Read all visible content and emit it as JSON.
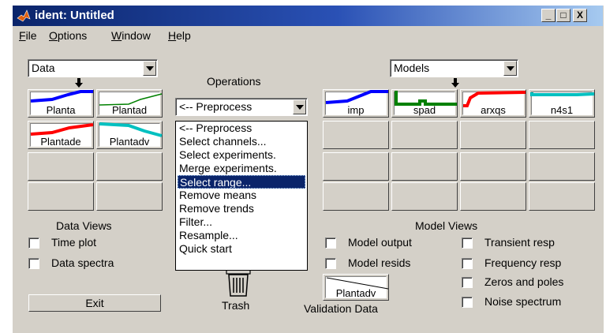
{
  "window": {
    "title": "ident: Untitled",
    "min": "_",
    "max": "□",
    "close": "X"
  },
  "menu": [
    {
      "first": "F",
      "rest": "ile"
    },
    {
      "first": "O",
      "rest": "ptions"
    },
    {
      "first": "W",
      "rest": "indow"
    },
    {
      "first": "H",
      "rest": "elp"
    }
  ],
  "data_popup": "Data",
  "models_popup": "Models",
  "operations": {
    "label": "Operations",
    "selected": "<-- Preprocess"
  },
  "data_slots": [
    "Planta",
    "Plantad",
    "Plantade",
    "Plantadv"
  ],
  "model_slots": [
    "imp",
    "spad",
    "arxqs",
    "n4s1"
  ],
  "data_views": {
    "title": "Data Views",
    "options": [
      "Time plot",
      "Data spectra"
    ]
  },
  "model_views": {
    "title": "Model Views",
    "left": [
      "Model output",
      "Model resids"
    ],
    "right": [
      "Transient resp",
      "Frequency resp",
      "Zeros and poles",
      "Noise spectrum"
    ]
  },
  "dropdown_items": [
    "<-- Preprocess",
    "Select channels...",
    "Select experiments.",
    "Merge experiments.",
    "Select range...",
    "Remove means",
    "Remove trends",
    "Filter...",
    "Resample...",
    "Quick start"
  ],
  "dropdown_selected_index": 4,
  "exit_label": "Exit",
  "trash_label": "Trash",
  "validation": {
    "slot": "Plantadv",
    "label": "Validation Data"
  },
  "colors": {
    "blue": "#0000ff",
    "green": "#008000",
    "red": "#ff0000",
    "cyan": "#00c0c0",
    "title_dark": "#0a246a",
    "face": "#d4d0c8"
  }
}
